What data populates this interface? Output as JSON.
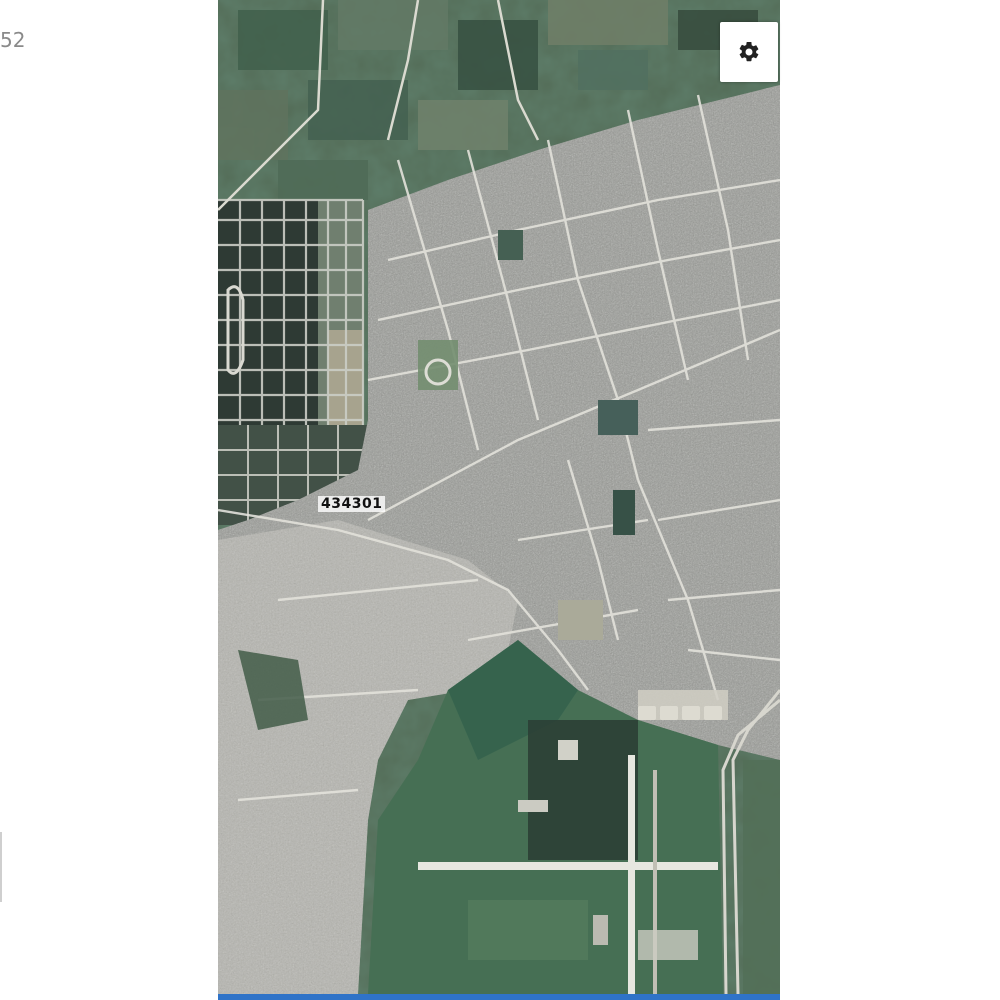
{
  "left_clipped_text": "52",
  "map": {
    "type": "satellite",
    "parcel_label": "434301"
  },
  "controls": {
    "settings_icon": "gear-icon"
  },
  "colors": {
    "accent_bar": "#2f73c8"
  }
}
